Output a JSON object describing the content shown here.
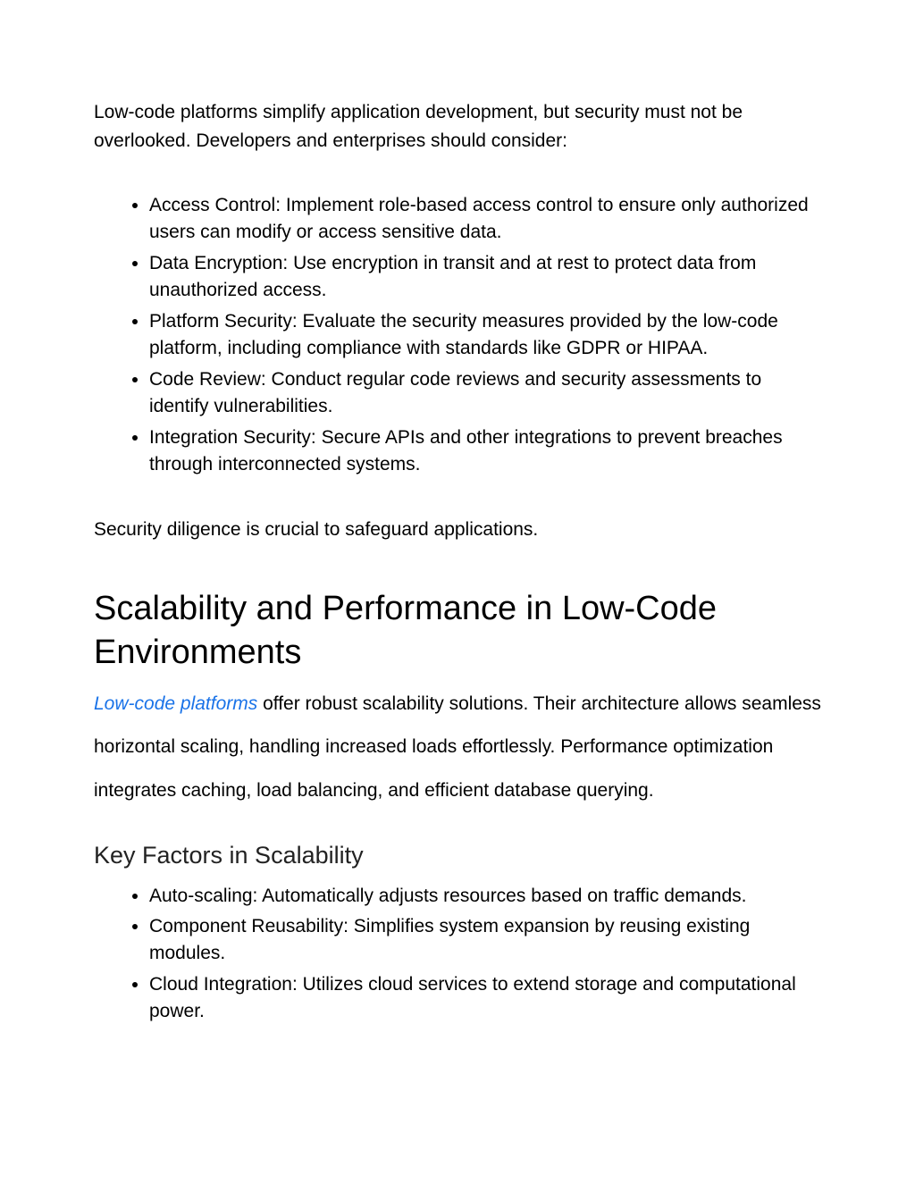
{
  "intro": "Low-code platforms simplify application development, but security must not be overlooked. Developers and enterprises should consider:",
  "securityItems": [
    "Access Control: Implement role-based access control to ensure only authorized users can modify or access sensitive data.",
    "Data Encryption: Use encryption in transit and at rest to protect data from unauthorized access.",
    "Platform Security: Evaluate the security measures provided by the low-code platform, including compliance with standards like GDPR or HIPAA.",
    "Code Review: Conduct regular code reviews and security assessments to identify vulnerabilities.",
    "Integration Security: Secure APIs and other integrations to prevent breaches through interconnected systems."
  ],
  "closing": "Security diligence is crucial to safeguard applications.",
  "heading": "Scalability and Performance in Low-Code Environments",
  "linkText": "Low-code platforms",
  "bodyRest": " offer robust scalability solutions. Their architecture allows seamless horizontal scaling, handling increased loads effortlessly. Performance optimization integrates caching, load balancing, and efficient database querying.",
  "subheading": "Key Factors in Scalability",
  "factors": [
    "Auto-scaling: Automatically adjusts resources based on traffic demands.",
    "Component Reusability: Simplifies system expansion by reusing existing modules.",
    "Cloud Integration: Utilizes cloud services to extend storage and computational power."
  ]
}
